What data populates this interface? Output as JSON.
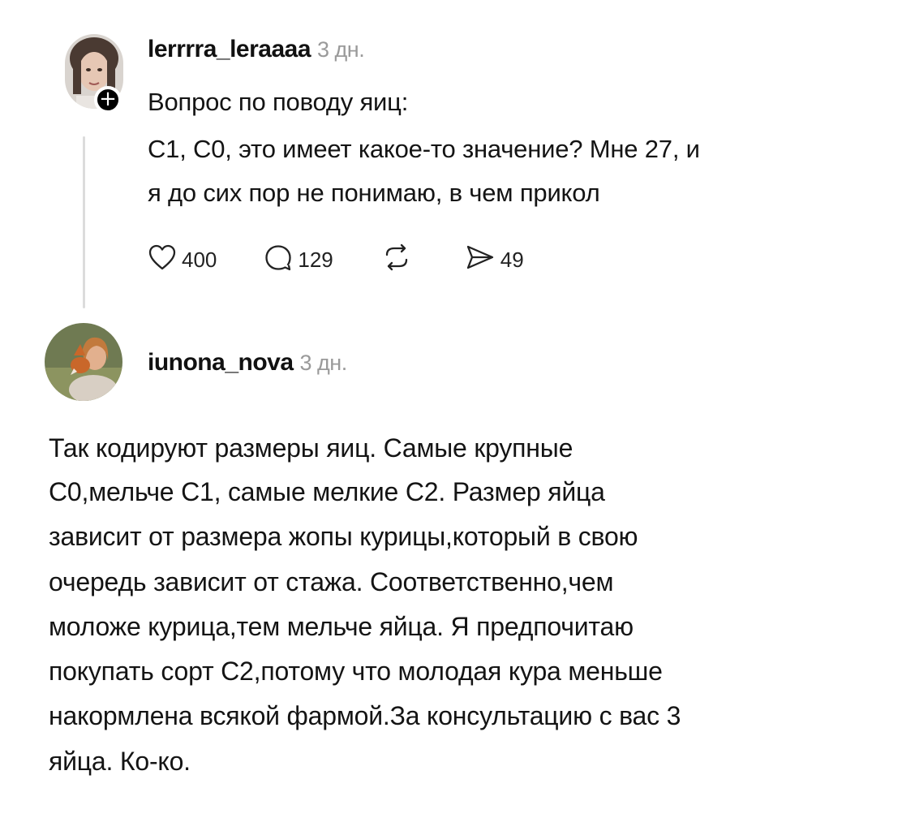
{
  "post": {
    "username": "lerrrra_leraaaa",
    "time": "3 дн.",
    "lines": [
      "Вопрос по поводу яиц:",
      "С1, С0, это имеет какое-то значение? Мне 27, и",
      "я до сих пор не понимаю, в чем прикол"
    ],
    "likes": "400",
    "comments": "129",
    "shares": "49"
  },
  "reply": {
    "username": "iunona_nova",
    "time": "3 дн.",
    "lines": [
      "Так кодируют размеры яиц. Самые крупные",
      "С0,мельче С1, самые мелкие С2. Размер яйца",
      "зависит от размера жопы курицы,который в свою",
      "очередь зависит от стажа. Соответственно,чем",
      "моложе курица,тем мельче яйца. Я предпочитаю",
      "покупать сорт С2,потому что молодая кура меньше",
      "накормлена всякой фармой.За консультацию с вас 3",
      "яйца. Ко-ко."
    ]
  },
  "icons": {
    "follow": "plus-icon",
    "like": "heart-icon",
    "comment": "comment-bubble-icon",
    "repost": "repost-icon",
    "share": "send-icon"
  }
}
